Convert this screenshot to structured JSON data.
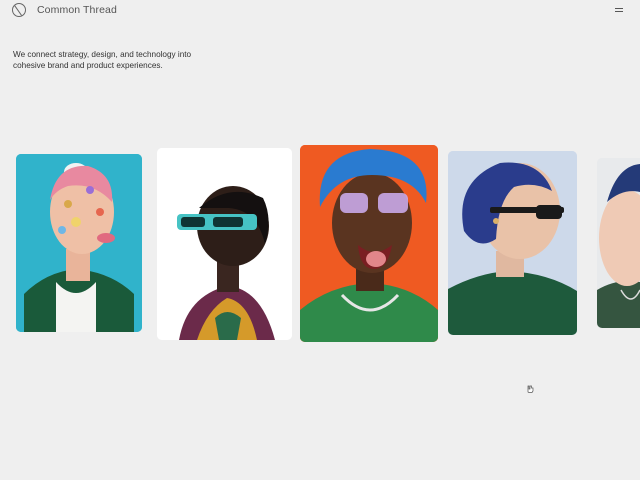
{
  "header": {
    "logo_icon": "circle-slash-icon",
    "brand": "Common Thread",
    "menu_icon": "menu-icon"
  },
  "hero": {
    "tagline": "We connect strategy, design, and technology into cohesive brand and product experiences."
  },
  "gallery": {
    "images": [
      {
        "description": "portrait-pink-hair-stickers",
        "bg": "#30b3cb"
      },
      {
        "description": "portrait-teal-sunglasses",
        "bg": "#ffffff"
      },
      {
        "description": "portrait-blue-hair-purple-glasses",
        "bg": "#ef5a22"
      },
      {
        "description": "portrait-blue-hair-profile",
        "bg": "#cdd9ea"
      },
      {
        "description": "portrait-partial",
        "bg": "#e8eaec"
      }
    ]
  },
  "cursor_icon": "hand-cursor-icon"
}
